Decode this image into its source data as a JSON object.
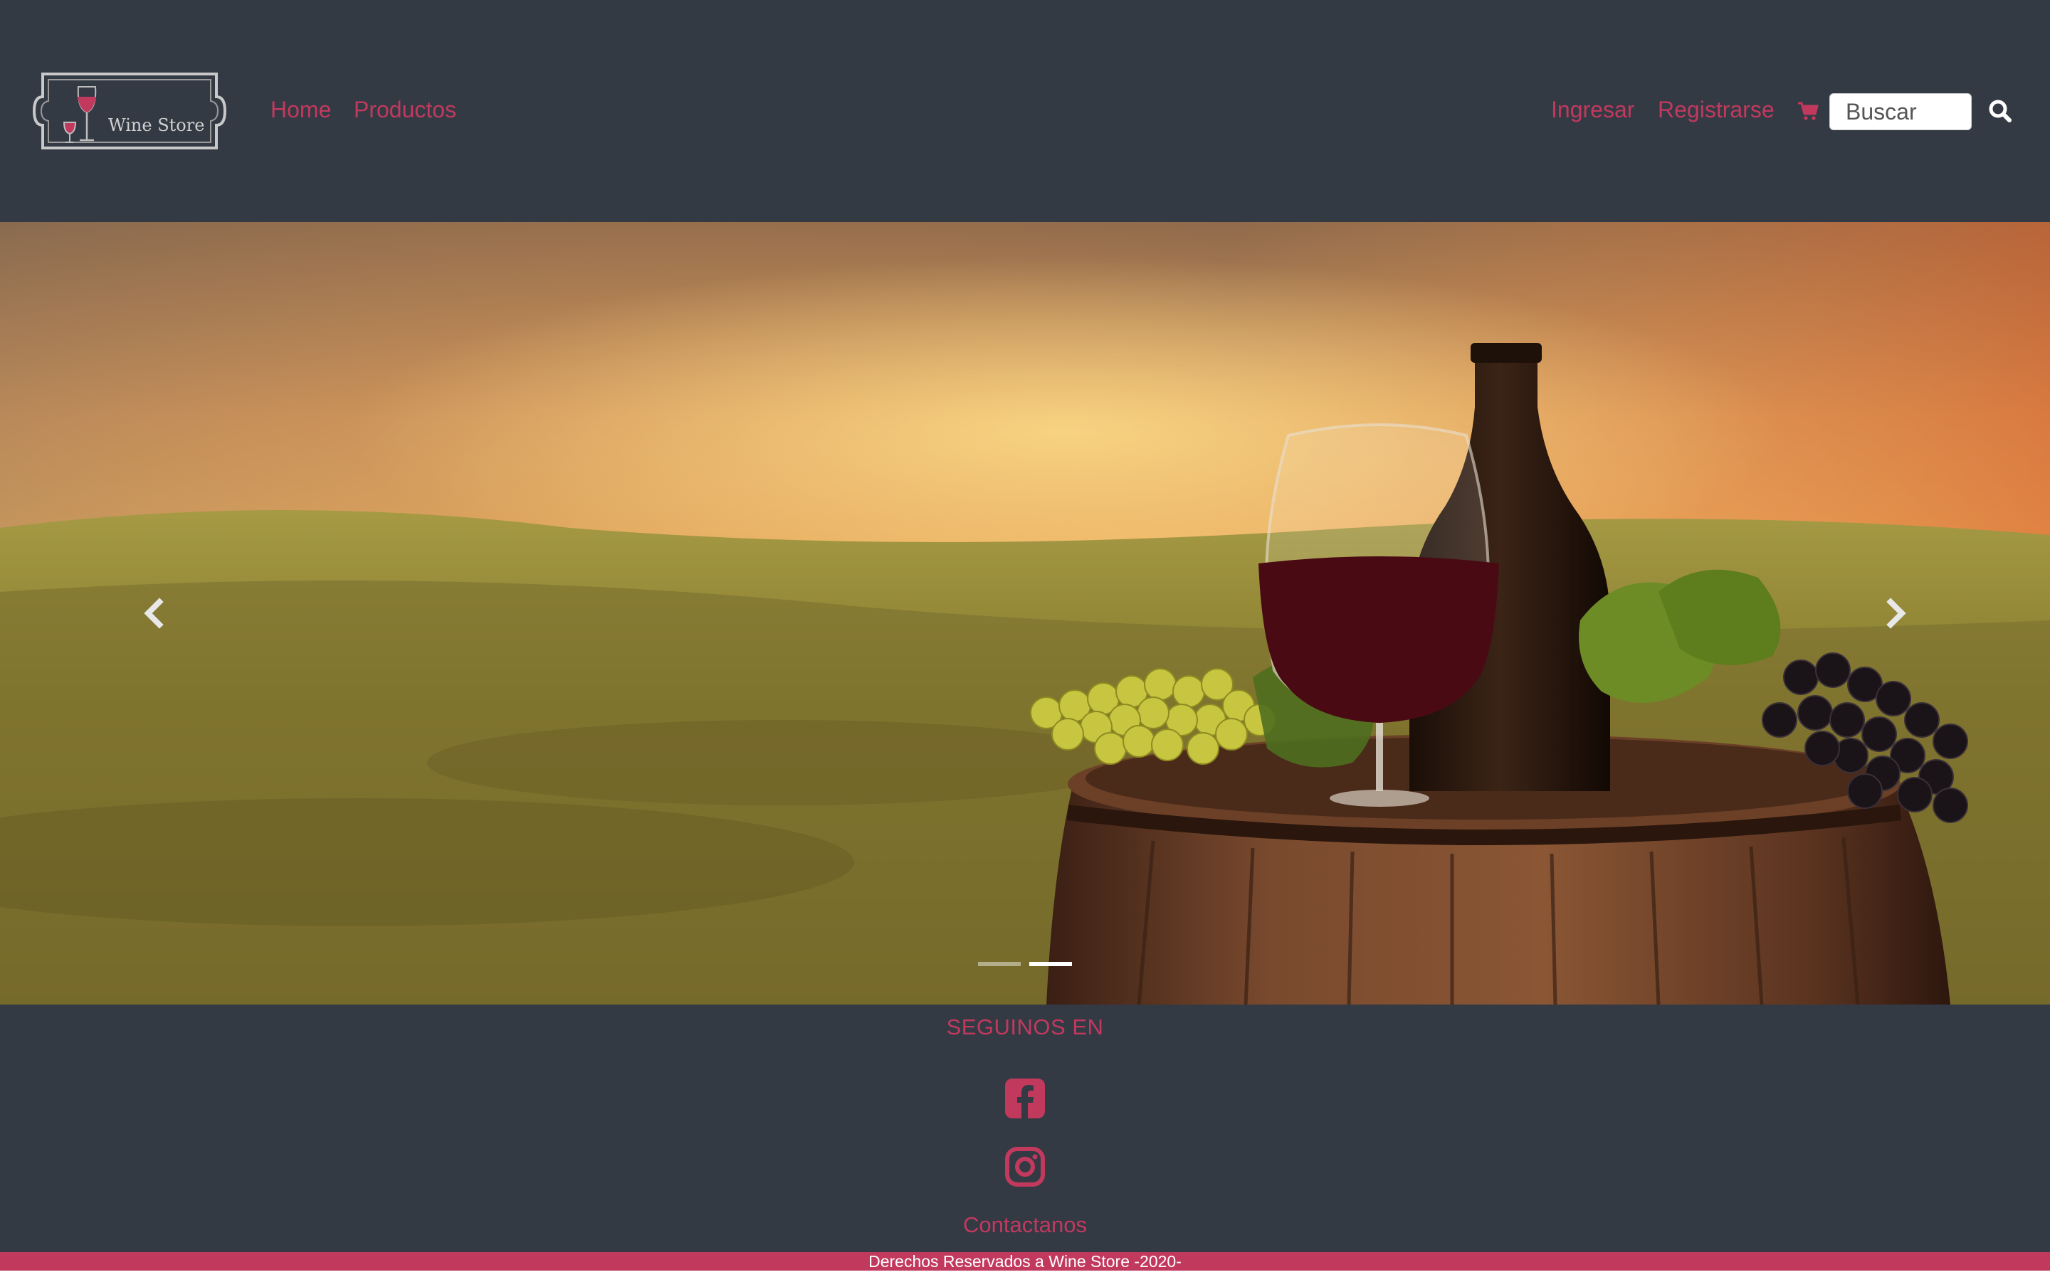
{
  "brand": {
    "logo_text": "Wine Store",
    "accent_color": "#c2395e",
    "navbar_color": "#343a44"
  },
  "nav": {
    "home_label": "Home",
    "products_label": "Productos",
    "login_label": "Ingresar",
    "register_label": "Registrarse",
    "cart_icon": "shopping-cart-icon",
    "search_placeholder": "Buscar",
    "search_icon": "search-icon"
  },
  "carousel": {
    "prev_icon": "chevron-left-icon",
    "next_icon": "chevron-right-icon",
    "slide_count": 2,
    "active_slide": 2
  },
  "footer": {
    "follow_title": "SEGUINOS EN",
    "social": [
      {
        "icon": "facebook-icon"
      },
      {
        "icon": "instagram-icon"
      }
    ],
    "contact_label": "Contactanos",
    "copyright": "Derechos Reservados a Wine Store -2020-"
  }
}
